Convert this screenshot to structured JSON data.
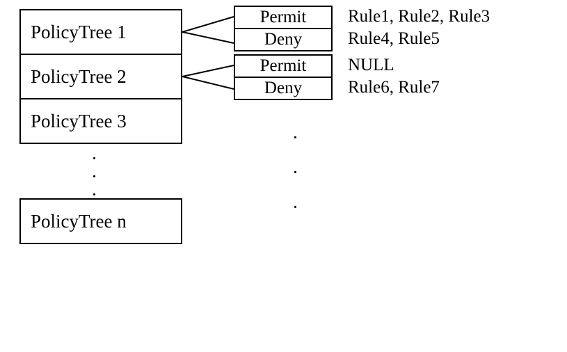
{
  "policies": {
    "p1": "PolicyTree 1",
    "p2": "PolicyTree 2",
    "p3": "PolicyTree 3",
    "pn": "PolicyTree n"
  },
  "decisions": {
    "d1_permit": "Permit",
    "d1_deny": "Deny",
    "d2_permit": "Permit",
    "d2_deny": "Deny"
  },
  "rules": {
    "r1": "Rule1, Rule2, Rule3",
    "r2": "Rule4, Rule5",
    "r3": "NULL",
    "r4": "Rule6, Rule7"
  },
  "chart_data": {
    "type": "diagram",
    "description": "PolicyTree structure with permit/deny branches",
    "trees": [
      {
        "name": "PolicyTree 1",
        "permit": [
          "Rule1",
          "Rule2",
          "Rule3"
        ],
        "deny": [
          "Rule4",
          "Rule5"
        ]
      },
      {
        "name": "PolicyTree 2",
        "permit": null,
        "deny": [
          "Rule6",
          "Rule7"
        ]
      },
      {
        "name": "PolicyTree 3"
      },
      {
        "name": "PolicyTree n"
      }
    ]
  }
}
